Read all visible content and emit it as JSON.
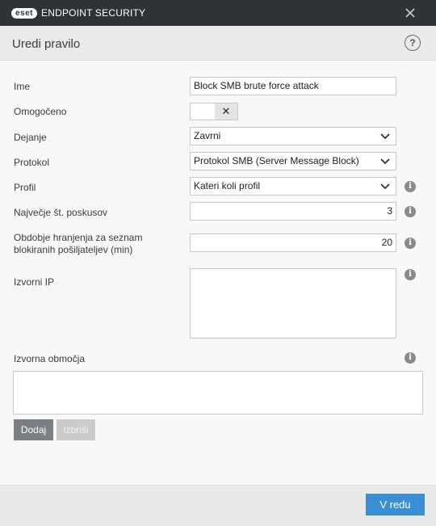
{
  "app": {
    "logo_text": "eset",
    "product_name": "ENDPOINT SECURITY"
  },
  "dialog": {
    "title": "Uredi pravilo",
    "help_symbol": "?"
  },
  "form": {
    "name": {
      "label": "Ime",
      "value": "Block SMB brute force attack"
    },
    "enabled": {
      "label": "Omogočeno",
      "state": "off",
      "symbol": "✕"
    },
    "action": {
      "label": "Dejanje",
      "value": "Zavrni"
    },
    "protocol": {
      "label": "Protokol",
      "value": "Protokol SMB (Server Message Block)"
    },
    "profile": {
      "label": "Profil",
      "value": "Kateri koli profil"
    },
    "max_attempts": {
      "label": "Največje št. poskusov",
      "value": "3"
    },
    "retention": {
      "label_line1": "Obdobje hranjenja za seznam",
      "label_line2": "blokiranih pošiljateljev (min)",
      "value": "20"
    },
    "source_ip": {
      "label": "Izvorni IP",
      "value": ""
    },
    "source_zones": {
      "label": "Izvorna območja"
    }
  },
  "buttons": {
    "add": "Dodaj",
    "delete": "Izbriši",
    "ok": "V redu"
  },
  "info_symbol": "i",
  "colors": {
    "titlebar": "#2f3237",
    "accent": "#3a8fd4",
    "background": "#f8f8f8"
  }
}
